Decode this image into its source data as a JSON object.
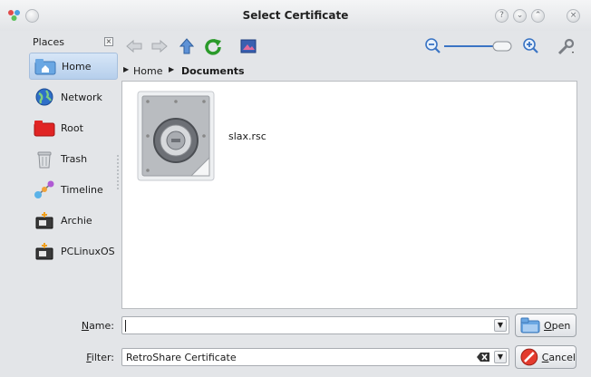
{
  "window": {
    "title": "Select Certificate"
  },
  "places": {
    "header": "Places",
    "items": [
      {
        "label": "Home",
        "icon": "home-folder-icon",
        "selected": true
      },
      {
        "label": "Network",
        "icon": "network-globe-icon",
        "selected": false
      },
      {
        "label": "Root",
        "icon": "root-folder-icon",
        "selected": false
      },
      {
        "label": "Trash",
        "icon": "trash-icon",
        "selected": false
      },
      {
        "label": "Timeline",
        "icon": "timeline-icon",
        "selected": false
      },
      {
        "label": "Archie",
        "icon": "drive-icon",
        "selected": false
      },
      {
        "label": "PCLinuxOS",
        "icon": "drive-icon",
        "selected": false
      }
    ]
  },
  "breadcrumb": {
    "items": [
      "Home",
      "Documents"
    ]
  },
  "files": [
    {
      "name": "slax.rsc",
      "icon": "vault-certificate-icon"
    }
  ],
  "name_field": {
    "label_prefix": "",
    "label_mnemonic": "N",
    "label_rest": "ame:",
    "value": ""
  },
  "filter_field": {
    "label_mnemonic": "F",
    "label_rest": "ilter:",
    "value": "RetroShare Certificate"
  },
  "buttons": {
    "open_mnemonic": "O",
    "open_rest": "pen",
    "cancel_mnemonic": "C",
    "cancel_rest": "ancel"
  },
  "colors": {
    "selection_bg": "#b6cfec",
    "window_bg": "#e3e5e8"
  }
}
